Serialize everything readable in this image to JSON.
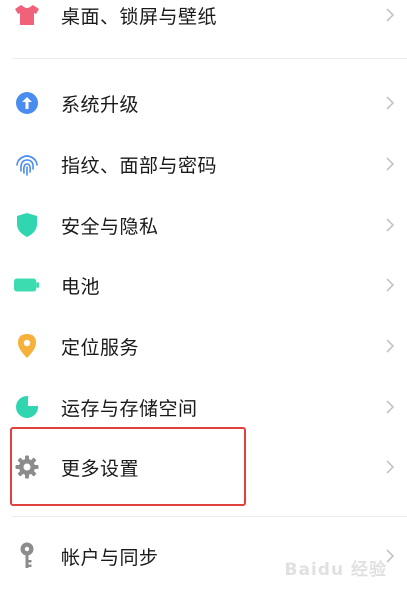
{
  "settings": {
    "items": [
      {
        "label": "桌面、锁屏与壁纸",
        "icon": "shirt-icon",
        "color": "#f0627a"
      },
      {
        "label": "系统升级",
        "icon": "arrow-up-circle-icon",
        "color": "#4a8df0"
      },
      {
        "label": "指纹、面部与密码",
        "icon": "fingerprint-icon",
        "color": "#4a8df0"
      },
      {
        "label": "安全与隐私",
        "icon": "shield-icon",
        "color": "#2fd6b0"
      },
      {
        "label": "电池",
        "icon": "battery-icon",
        "color": "#3ddcb0"
      },
      {
        "label": "定位服务",
        "icon": "location-pin-icon",
        "color": "#f6b13c"
      },
      {
        "label": "运存与存储空间",
        "icon": "pie-chart-icon",
        "color": "#2fd6b0"
      },
      {
        "label": "更多设置",
        "icon": "gear-icon",
        "color": "#8c8c8c"
      },
      {
        "label": "帐户与同步",
        "icon": "key-icon",
        "color": "#8c8c8c"
      }
    ]
  },
  "annotation": {
    "color": "#e0413a"
  },
  "watermark": {
    "text": "Baidu 经验"
  }
}
